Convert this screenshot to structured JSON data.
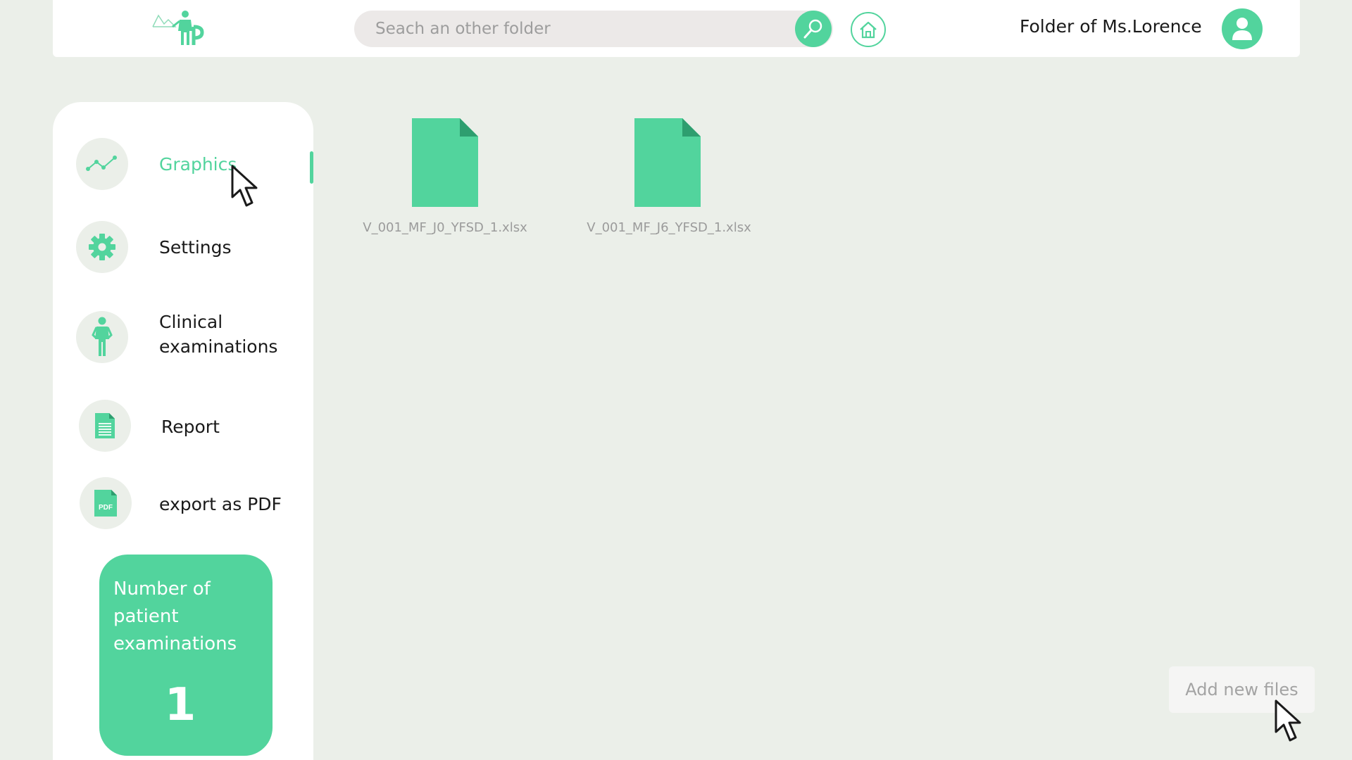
{
  "header": {
    "search_placeholder": "Seach an other folder",
    "folder_label": "Folder of  Ms.Lorence"
  },
  "sidebar": {
    "items": [
      {
        "label": "Graphics",
        "icon": "chart-line-icon",
        "active": true
      },
      {
        "label": "Settings",
        "icon": "gear-icon",
        "active": false
      },
      {
        "label": "Clinical examinations",
        "icon": "person-icon",
        "active": false
      },
      {
        "label": "Report",
        "icon": "document-icon",
        "active": false
      },
      {
        "label": "export as PDF",
        "icon": "pdf-icon",
        "active": false
      }
    ],
    "stat_card": {
      "title": "Number of patient examinations",
      "value": "1"
    }
  },
  "files": [
    {
      "name": "V_001_MF_J0_YFSD_1.xlsx"
    },
    {
      "name": "V_001_MF_J6_YFSD_1.xlsx"
    }
  ],
  "pdf_badge": "PDF",
  "add_files_label": "Add new files",
  "colors": {
    "accent": "#52d49d",
    "accent_dark": "#2e9e6f",
    "background": "#ebefe9"
  }
}
